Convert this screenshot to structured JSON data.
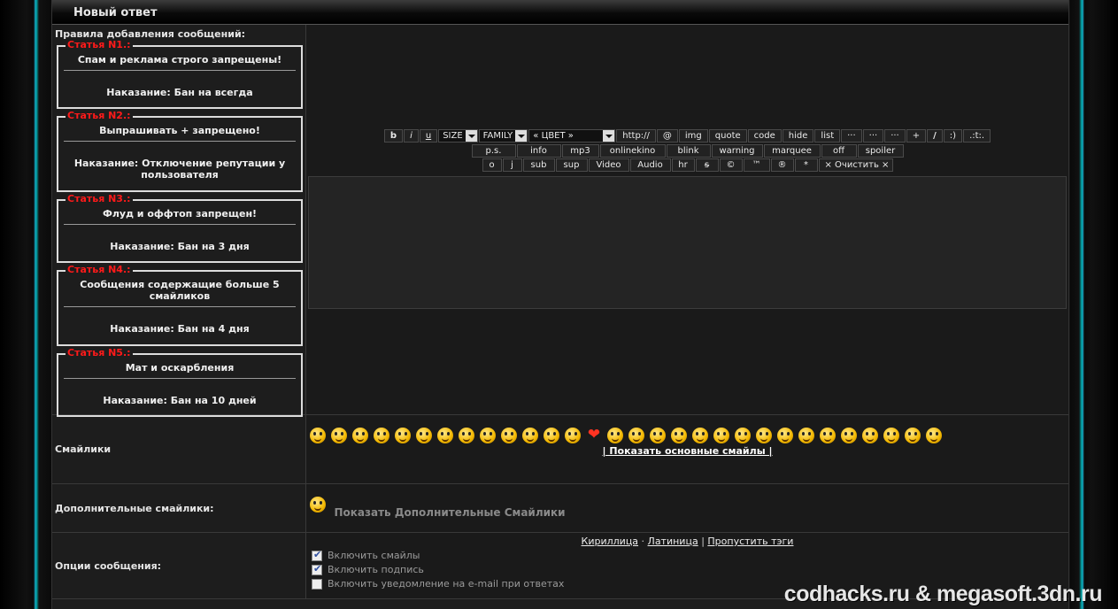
{
  "form": {
    "title": "Новый ответ"
  },
  "rules": {
    "heading": "Правила добавления сообщений:",
    "items": [
      {
        "tag": "Статья N1.:",
        "text": "Спам и реклама строго запрещены!",
        "penalty": "Наказание: Бан на всегда"
      },
      {
        "tag": "Статья N2.:",
        "text": "Выпрашивать + запрещено!",
        "penalty": "Наказание: Отключение репутации у пользователя"
      },
      {
        "tag": "Статья N3.:",
        "text": "Флуд и оффтоп запрещен!",
        "penalty": "Наказание: Бан на 3 дня"
      },
      {
        "tag": "Статья N4.:",
        "text": "Сообщения содержащие больше 5 смайликов",
        "penalty": "Наказание: Бан на 4 дня"
      },
      {
        "tag": "Статья N5.:",
        "text": "Мат и оскарбления",
        "penalty": "Наказание: Бан на 10 дней"
      }
    ]
  },
  "toolbar": {
    "row1": {
      "b": "b",
      "i": "i",
      "u": "u",
      "size": "SIZE",
      "family": "FAMILY",
      "color": "« ЦВЕТ »",
      "http": "http://",
      "at": "@",
      "img": "img",
      "quote": "quote",
      "code": "code",
      "hide": "hide",
      "list": "list",
      "dots1": "···",
      "dots2": "···",
      "dots3": "···",
      "plus": "+",
      "slash": "/",
      "smile": ":)",
      "extra": ".:t:."
    },
    "row2": [
      "p.s.",
      "info",
      "mp3",
      "onlinekino",
      "blink",
      "warning",
      "marquee",
      "off",
      "spoiler"
    ],
    "row3": [
      "o",
      "j",
      "sub",
      "sup",
      "Video",
      "Audio",
      "hr",
      "s",
      "©",
      "™",
      "®",
      "*",
      "× Очистить ×"
    ]
  },
  "smiles": {
    "label": "Смайлики",
    "show_main": "| Показать основные смайлы |",
    "icons": [
      "smile-icon",
      "sad-icon",
      "laugh-icon",
      "angry-icon",
      "neutral-icon",
      "reading-icon",
      "nerd-icon",
      "shocked-icon",
      "scared-icon",
      "wink-icon",
      "tongue-icon",
      "whistle-icon",
      "cry-icon",
      "heart-icon",
      "help-icon",
      "king-icon",
      "magnifier-icon",
      "happy-icon",
      "dizzy-icon",
      "wave-icon",
      "grin-icon",
      "surprised-icon",
      "confused-icon",
      "gun-icon",
      "rooster-icon",
      "mad-icon",
      "devil-icon",
      "party-icon",
      "trophy-icon",
      "cool-icon"
    ]
  },
  "extra_smiles": {
    "label": "Дополнительные смайлики:",
    "link": "Показать Дополнительные Смайлики"
  },
  "options": {
    "label": "Опции сообщения:",
    "links": {
      "cyrillic": "Кириллица",
      "sep1": "·",
      "latin": "Латиница",
      "sep2": "|",
      "skip": "Пропустить тэги"
    },
    "items": [
      {
        "label": "Включить смайлы",
        "checked": true
      },
      {
        "label": "Включить подпись",
        "checked": true
      },
      {
        "label": "Включить уведомление на e-mail при ответах",
        "checked": false
      }
    ]
  },
  "watermark": "codhacks.ru & megasoft.3dn.ru"
}
